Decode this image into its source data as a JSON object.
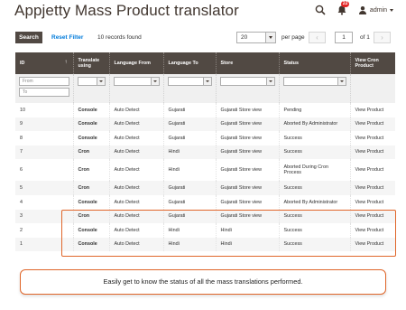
{
  "header": {
    "title": "Appjetty Mass Product translator",
    "notification_count": "22",
    "user_label": "admin"
  },
  "toolbar": {
    "search_label": "Search",
    "reset_label": "Reset Filter",
    "records_found": "10 records found",
    "per_page_value": "20",
    "per_page_label": "per page",
    "page_value": "1",
    "page_of": "of 1"
  },
  "columns": {
    "id": "ID",
    "translate_using": "Translate using",
    "language_from": "Language From",
    "language_to": "Language To",
    "store": "Store",
    "status": "Status",
    "view": "View Cron Product"
  },
  "filters": {
    "from_placeholder": "From",
    "to_placeholder": "To"
  },
  "rows": [
    {
      "id": "10",
      "type": "Console",
      "from": "Auto Detect",
      "to": "Gujarati",
      "store": "Gujarati Store view",
      "status": "Pending",
      "link": "View Product"
    },
    {
      "id": "9",
      "type": "Console",
      "from": "Auto Detect",
      "to": "Gujarati",
      "store": "Gujarati Store view",
      "status": "Aborted By Administrator",
      "link": "View Product"
    },
    {
      "id": "8",
      "type": "Console",
      "from": "Auto Detect",
      "to": "Gujarati",
      "store": "Gujarati Store view",
      "status": "Success",
      "link": "View Product"
    },
    {
      "id": "7",
      "type": "Cron",
      "from": "Auto Detect",
      "to": "Hindi",
      "store": "Gujarati Store view",
      "status": "Success",
      "link": "View Product"
    },
    {
      "id": "6",
      "type": "Cron",
      "from": "Auto Detect",
      "to": "Hindi",
      "store": "Gujarati Store view",
      "status": "Aborted During Cron Process",
      "link": "View Product"
    },
    {
      "id": "5",
      "type": "Cron",
      "from": "Auto Detect",
      "to": "Gujarati",
      "store": "Gujarati Store view",
      "status": "Success",
      "link": "View Product"
    },
    {
      "id": "4",
      "type": "Console",
      "from": "Auto Detect",
      "to": "Gujarati",
      "store": "Gujarati Store view",
      "status": "Aborted By Administrator",
      "link": "View Product"
    },
    {
      "id": "3",
      "type": "Cron",
      "from": "Auto Detect",
      "to": "Gujarati",
      "store": "Gujarati Store view",
      "status": "Success",
      "link": "View Product"
    },
    {
      "id": "2",
      "type": "Console",
      "from": "Auto Detect",
      "to": "Hindi",
      "store": "Hindi",
      "status": "Success",
      "link": "View Product"
    },
    {
      "id": "1",
      "type": "Console",
      "from": "Auto Detect",
      "to": "Hindi",
      "store": "Hindi",
      "status": "Success",
      "link": "View Product"
    }
  ],
  "callout": "Easily get to know the status of all the mass translations performed.",
  "colors": {
    "header_bg": "#514943",
    "link": "#007bdb",
    "highlight": "#e0662a",
    "badge": "#e22626"
  }
}
